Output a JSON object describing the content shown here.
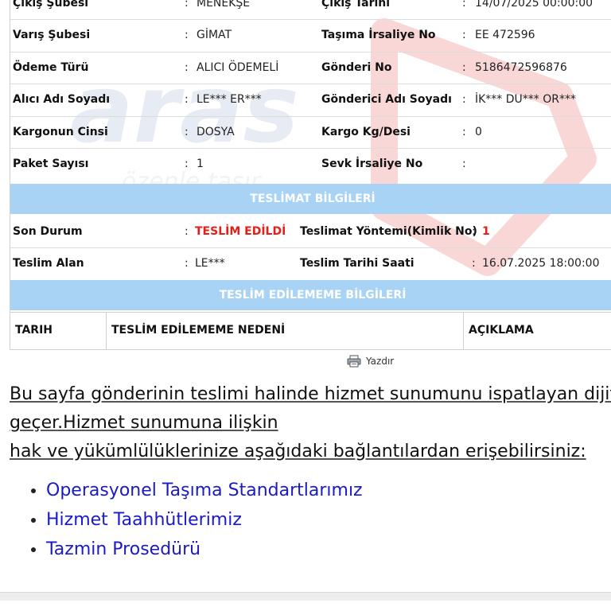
{
  "shipment": {
    "rows": [
      {
        "l1": "Çıkış Şubesi",
        "v1": "MENEKŞE",
        "l2": "Çıkış Tarihi",
        "v2": "14/07/2025 00:00:00"
      },
      {
        "l1": "Varış Şubesi",
        "v1": "GİMAT",
        "l2": "Taşıma İrsaliye No",
        "v2": "EE 472596"
      },
      {
        "l1": "Ödeme Türü",
        "v1": "ALICI ÖDEMELİ",
        "l2": "Gönderi No",
        "v2": "5186472596876"
      },
      {
        "l1": "Alıcı Adı Soyadı",
        "v1": "LE*** ER***",
        "l2": "Gönderici Adı Soyadı",
        "v2": "İK*** DU*** OR***"
      },
      {
        "l1": "Kargonun Cinsi",
        "v1": "DOSYA",
        "l2": "Kargo Kg/Desi",
        "v2": "0"
      },
      {
        "l1": "Paket Sayısı",
        "v1": "1",
        "l2": "Sevk İrsaliye No",
        "v2": ""
      }
    ],
    "colon": ":"
  },
  "delivery": {
    "header": "TESLİMAT BİLGİLERİ",
    "status_label": "Son Durum",
    "status_value": "TESLİM EDİLDİ",
    "method_label": "Teslimat Yöntemi(Kimlik No)",
    "method_value": "1",
    "receiver_label": "Teslim Alan",
    "receiver_value": "LE***",
    "date_label": "Teslim Tarihi Saati",
    "date_value": "16.07.2025 18:00:00"
  },
  "undelivered": {
    "header": "TESLİM EDİLEMEME BİLGİLERİ",
    "columns": [
      "TARIH",
      "TESLİM EDİLEMEME NEDENİ",
      "AÇIKLAMA"
    ]
  },
  "print_label": "Yazdır",
  "notice": {
    "line1": "Bu sayfa gönderinin teslimi halinde hizmet sunumunu ispatlayan dijital",
    "line2": "geçer.Hizmet sunumuna ilişkin",
    "line3": "hak ve yükümlülüklerinize aşağıdaki bağlantılardan erişebilirsiniz:"
  },
  "links": [
    "Operasyonel Taşıma Standartlarımız",
    "Hizmet Taahhütlerimiz",
    "Tazmin Prosedürü"
  ],
  "watermark": {
    "brand": "aras",
    "tagline": "özenle taşır"
  },
  "colors": {
    "header_bg": "#a9d3f5",
    "status_red": "#e0201a",
    "link_blue": "#1a1ac8"
  }
}
